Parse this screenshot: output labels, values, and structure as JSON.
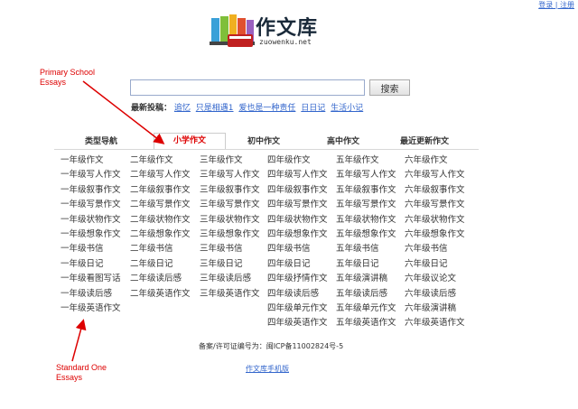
{
  "header": {
    "top_link": "登录 | 注册",
    "logo_text": "作文库",
    "logo_url": "zuowenku.net"
  },
  "search": {
    "button_label": "搜索",
    "latest_label": "最新投稿：",
    "latest_links": [
      "追忆",
      "只是相遇1",
      "爱也是一种责任",
      "日日记",
      "生活小记"
    ]
  },
  "tabs": [
    {
      "label": "类型导航",
      "active": false
    },
    {
      "label": "小学作文",
      "active": true
    },
    {
      "label": "初中作文",
      "active": false
    },
    {
      "label": "高中作文",
      "active": false
    },
    {
      "label": "最近更新作文",
      "active": false
    }
  ],
  "columns": [
    [
      "一年级作文",
      "一年级写人作文",
      "一年级叙事作文",
      "一年级写景作文",
      "一年级状物作文",
      "一年级想象作文",
      "一年级书信",
      "一年级日记",
      "一年级看图写话",
      "一年级读后感",
      "一年级英语作文"
    ],
    [
      "二年级作文",
      "二年级写人作文",
      "二年级叙事作文",
      "二年级写景作文",
      "二年级状物作文",
      "二年级想象作文",
      "二年级书信",
      "二年级日记",
      "二年级读后感",
      "二年级英语作文"
    ],
    [
      "三年级作文",
      "三年级写人作文",
      "三年级叙事作文",
      "三年级写景作文",
      "三年级状物作文",
      "三年级想象作文",
      "三年级书信",
      "三年级日记",
      "三年级读后感",
      "三年级英语作文"
    ],
    [
      "四年级作文",
      "四年级写人作文",
      "四年级叙事作文",
      "四年级写景作文",
      "四年级状物作文",
      "四年级想象作文",
      "四年级书信",
      "四年级日记",
      "四年级抒情作文",
      "四年级读后感",
      "四年级单元作文",
      "四年级英语作文"
    ],
    [
      "五年级作文",
      "五年级写人作文",
      "五年级叙事作文",
      "五年级写景作文",
      "五年级状物作文",
      "五年级想象作文",
      "五年级书信",
      "五年级日记",
      "五年级演讲稿",
      "五年级读后感",
      "五年级单元作文",
      "五年级英语作文"
    ],
    [
      "六年级作文",
      "六年级写人作文",
      "六年级叙事作文",
      "六年级写景作文",
      "六年级状物作文",
      "六年级想象作文",
      "六年级书信",
      "六年级日记",
      "六年级议论文",
      "六年级读后感",
      "六年级演讲稿",
      "六年级英语作文"
    ]
  ],
  "footer": {
    "icp": "备案/许可证编号为：闽ICP备11002824号-5",
    "mobile_link": "作文库手机版"
  },
  "annotations": {
    "top_line1": "Primary School",
    "top_line2": "Essays",
    "bottom_line1": "Standard One",
    "bottom_line2": "Essays",
    "color": "#dd0000"
  }
}
